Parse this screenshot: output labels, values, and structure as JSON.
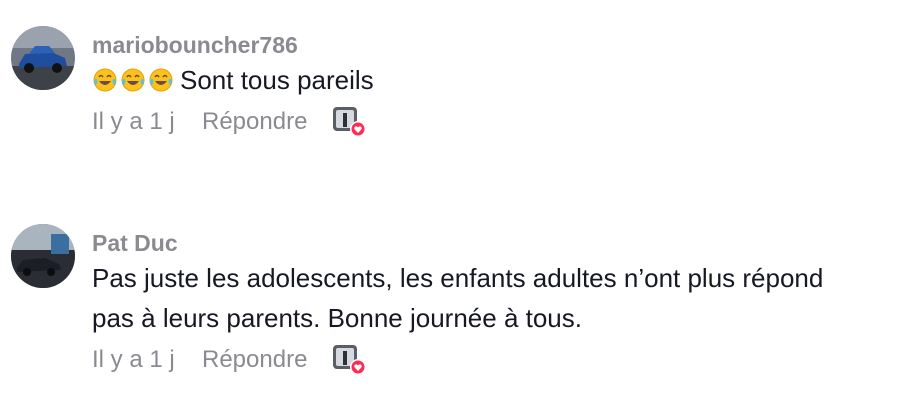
{
  "comments": [
    {
      "username": "mariobouncher786",
      "emojis": [
        "laughing-tears-emoji",
        "laughing-tears-emoji",
        "laughing-tears-emoji"
      ],
      "text": "Sont tous pareils",
      "time": "Il y a 1 j",
      "reply_label": "Répondre",
      "creator_liked_icon": "creator-liked-heart-icon"
    },
    {
      "username": "Pat Duc",
      "text_lines": [
        "Pas juste les adolescents, les enfants adultes n’ont plus répond",
        "pas à leurs parents. Bonne journée à tous."
      ],
      "time": "Il y a 1 j",
      "reply_label": "Répondre",
      "creator_liked_icon": "creator-liked-heart-icon"
    }
  ],
  "colors": {
    "primary_text": "#161823",
    "secondary_text": "#8a8b91",
    "heart": "#fe2c55"
  }
}
